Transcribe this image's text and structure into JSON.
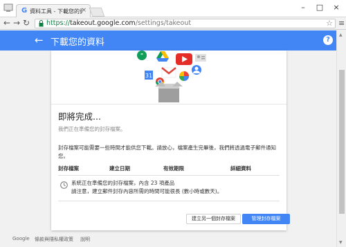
{
  "browser": {
    "tab_title": "資料工具 - 下載您的資料",
    "tab_favicon": "G",
    "close_glyph": "×",
    "url_scheme": "https://",
    "url_host": "takeout.google.com",
    "url_path": "/settings/takeout",
    "back_glyph": "←",
    "forward_glyph": "→",
    "reload_glyph": "↻",
    "star_glyph": "☆",
    "menu_glyph": "≡",
    "minimize_glyph": "–",
    "maximize_glyph": "□",
    "window_close_glyph": "×"
  },
  "appbar": {
    "title": "下載您的資料",
    "back_glyph": "←",
    "help_glyph": "?",
    "color": "#4285f4"
  },
  "card": {
    "hero_icons": [
      "hangouts-icon",
      "drive-icon",
      "youtube-icon",
      "contacts-icon",
      "calendar-icon",
      "gmail-icon",
      "photos-icon",
      "profile-icon",
      "chrome-icon",
      "box-icon"
    ],
    "heading": "即將完成...",
    "subtitle": "我們正在準備您的封存檔案。",
    "notice": "封存檔案可能需要一些時間才能供您下載。請放心，檔案產生完畢後，我們將透過電子郵件通知您。",
    "columns": [
      "封存檔案",
      "建立日期",
      "有效期限",
      "詳細資料"
    ],
    "status_line1": "系統正在準備您的封存檔案，內含 23 項產品",
    "status_line2": "請注意，建立郵件封存內容所需的時間可能很長 (數小時或數天)。",
    "secondary_button": "建立另一個封存檔案",
    "primary_button": "管理封存檔案"
  },
  "footer": {
    "links": [
      "Google",
      "條款與隱私權政策",
      "說明"
    ]
  }
}
